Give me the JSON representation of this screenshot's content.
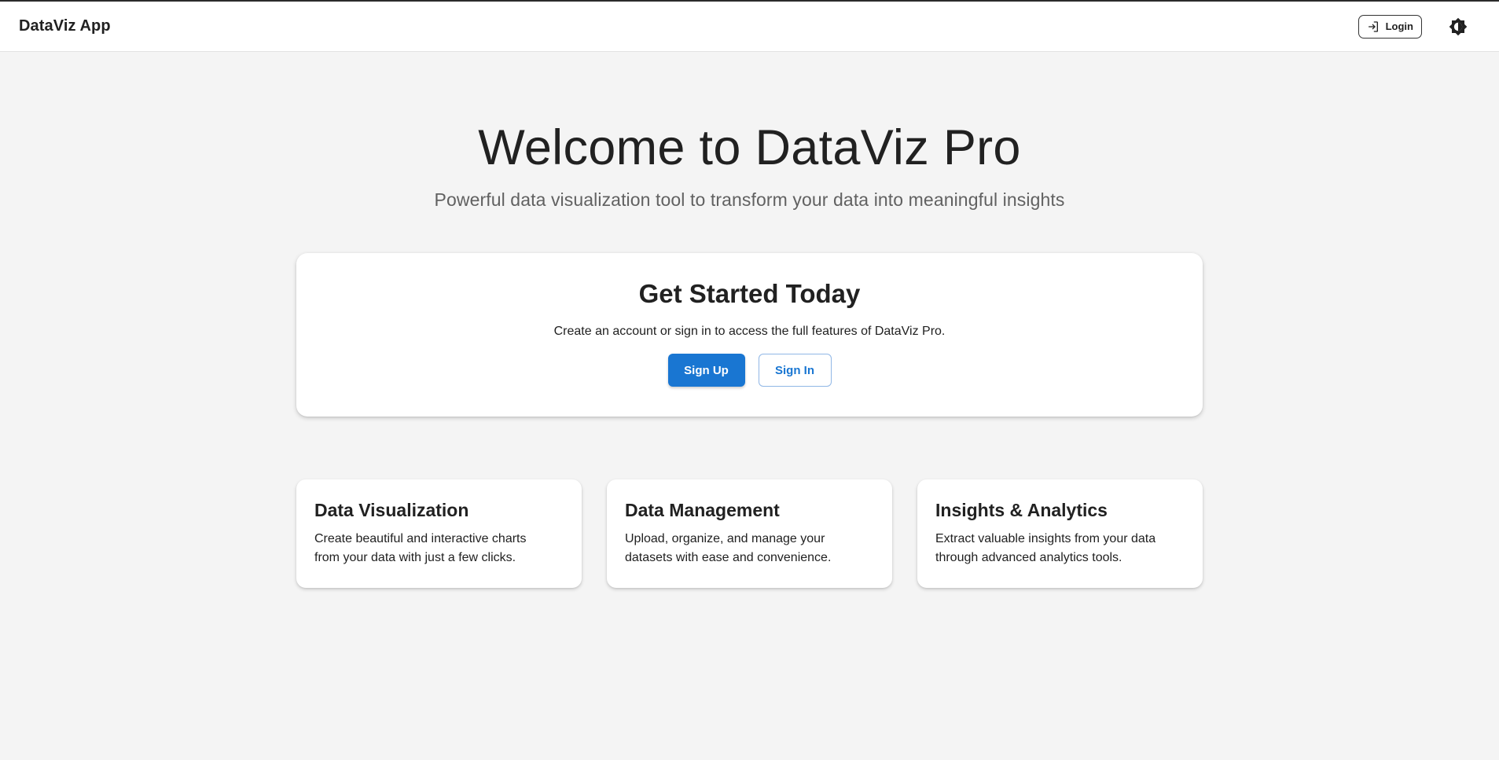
{
  "appbar": {
    "brand": "DataViz App",
    "login_label": "Login",
    "login_icon": "login-icon",
    "theme_icon": "brightness-icon"
  },
  "hero": {
    "title": "Welcome to DataViz Pro",
    "subtitle": "Powerful data visualization tool to transform your data into meaningful insights"
  },
  "cta": {
    "title": "Get Started Today",
    "text": "Create an account or sign in to access the full features of DataViz Pro.",
    "signup_label": "Sign Up",
    "signin_label": "Sign In"
  },
  "features": [
    {
      "title": "Data Visualization",
      "text": "Create beautiful and interactive charts from your data with just a few clicks."
    },
    {
      "title": "Data Management",
      "text": "Upload, organize, and manage your datasets with ease and convenience."
    },
    {
      "title": "Insights & Analytics",
      "text": "Extract valuable insights from your data through advanced analytics tools."
    }
  ],
  "colors": {
    "primary": "#1976d2",
    "background": "#f4f4f4",
    "surface": "#ffffff",
    "text": "#212121",
    "muted": "#616161"
  }
}
